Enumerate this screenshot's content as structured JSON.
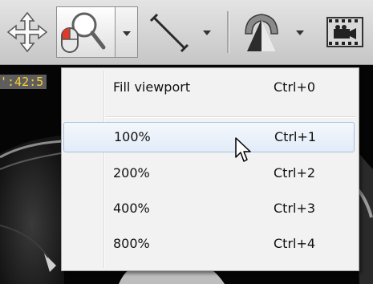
{
  "viewport": {
    "overlay_text": "':42:5"
  },
  "toolbar": {
    "tools": [
      {
        "name": "pan",
        "icon": "move-arrows-icon"
      },
      {
        "name": "zoom",
        "icon": "magnifier-mouse-icon",
        "active": true
      },
      {
        "name": "measure",
        "icon": "ruler-line-icon"
      },
      {
        "name": "shape",
        "icon": "region-shape-icon"
      },
      {
        "name": "cine",
        "icon": "film-camera-icon"
      }
    ]
  },
  "zoom_menu": {
    "items": [
      {
        "label": "Fill viewport",
        "shortcut": "Ctrl+0"
      },
      {
        "label": "100%",
        "shortcut": "Ctrl+1",
        "hovered": true
      },
      {
        "label": "200%",
        "shortcut": "Ctrl+2"
      },
      {
        "label": "400%",
        "shortcut": "Ctrl+3"
      },
      {
        "label": "800%",
        "shortcut": "Ctrl+4"
      }
    ]
  },
  "colors": {
    "overlay_text": "#ffcf33",
    "menu_background": "#f2f2f2",
    "hover_border": "#a6c1e0"
  }
}
